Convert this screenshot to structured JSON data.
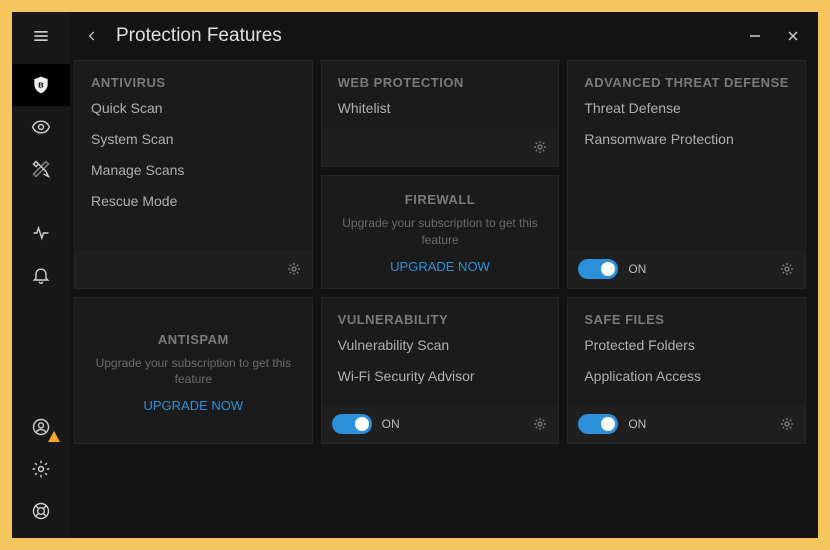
{
  "title": "Protection Features",
  "upgrade_sub": "Upgrade your subscription to get this feature",
  "upgrade_link": "UPGRADE NOW",
  "toggle_on": "ON",
  "cards": {
    "antivirus": {
      "title": "ANTIVIRUS",
      "items": [
        "Quick Scan",
        "System Scan",
        "Manage Scans",
        "Rescue Mode"
      ]
    },
    "web": {
      "title": "WEB PROTECTION",
      "items": [
        "Whitelist"
      ]
    },
    "atd": {
      "title": "ADVANCED THREAT DEFENSE",
      "items": [
        "Threat Defense",
        "Ransomware Protection"
      ]
    },
    "firewall": {
      "title": "FIREWALL"
    },
    "antispam": {
      "title": "ANTISPAM"
    },
    "vuln": {
      "title": "VULNERABILITY",
      "items": [
        "Vulnerability Scan",
        "Wi-Fi Security Advisor"
      ]
    },
    "safe": {
      "title": "SAFE FILES",
      "items": [
        "Protected Folders",
        "Application Access"
      ]
    }
  }
}
